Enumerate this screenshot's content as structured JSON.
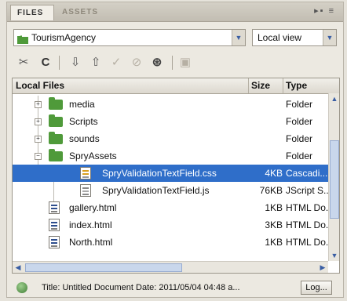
{
  "tabs": [
    {
      "label": "FILES",
      "active": true
    },
    {
      "label": "ASSETS",
      "active": false
    }
  ],
  "panel_menu_icon": "panel-menu-icon",
  "site_select": {
    "value": "TourismAgency",
    "icon": "site-folder-icon"
  },
  "view_select": {
    "value": "Local view"
  },
  "toolbar": {
    "connect": "connect-icon",
    "refresh": "refresh-icon",
    "get": "get-files-icon",
    "put": "put-files-icon",
    "checkout": "check-out-icon",
    "checkin": "check-in-icon",
    "sync": "synchronize-icon",
    "expand": "expand-panel-icon"
  },
  "list": {
    "headers": {
      "name": "Local Files",
      "size": "Size",
      "type": "Type"
    },
    "rows": [
      {
        "name": "media",
        "size": "",
        "type": "Folder",
        "kind": "folder",
        "expander": "+"
      },
      {
        "name": "Scripts",
        "size": "",
        "type": "Folder",
        "kind": "folder",
        "expander": "+"
      },
      {
        "name": "sounds",
        "size": "",
        "type": "Folder",
        "kind": "folder",
        "expander": "+"
      },
      {
        "name": "SpryAssets",
        "size": "",
        "type": "Folder",
        "kind": "folder",
        "expander": "−"
      },
      {
        "name": "SpryValidationTextField.css",
        "size": "4KB",
        "type": "Cascadi...",
        "kind": "css",
        "selected": true
      },
      {
        "name": "SpryValidationTextField.js",
        "size": "76KB",
        "type": "JScript S...",
        "kind": "js"
      },
      {
        "name": "gallery.html",
        "size": "1KB",
        "type": "HTML Do...",
        "kind": "html"
      },
      {
        "name": "index.html",
        "size": "3KB",
        "type": "HTML Do...",
        "kind": "html"
      },
      {
        "name": "North.html",
        "size": "1KB",
        "type": "HTML Do...",
        "kind": "html"
      }
    ]
  },
  "status": {
    "text": "Title: Untitled Document  Date: 2011/05/04 04:48 a...",
    "log_label": "Log..."
  },
  "colors": {
    "selection": "#2f6ec9",
    "folder": "#4f9a3a"
  }
}
